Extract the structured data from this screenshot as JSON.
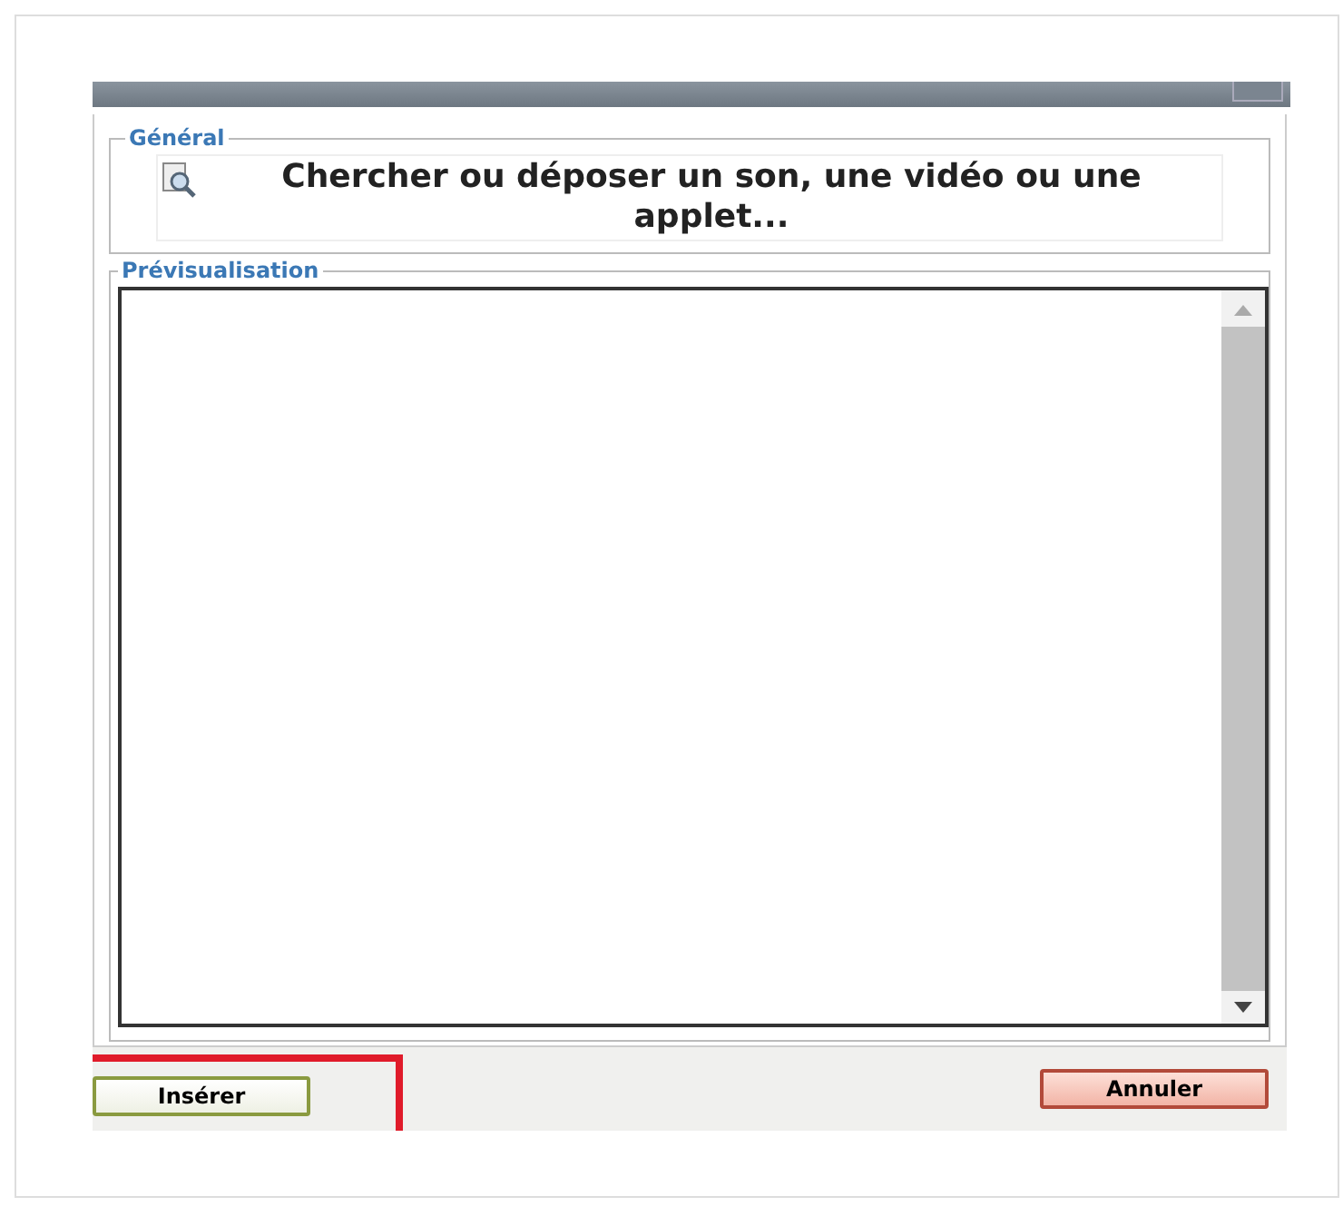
{
  "general": {
    "legend": "Général",
    "search_button": "Chercher ou déposer un son, une vidéo ou une applet..."
  },
  "preview": {
    "legend": "Prévisualisation"
  },
  "buttons": [
    {
      "label": "Insérer",
      "kind": "confirm",
      "highlighted": true
    },
    {
      "label": "Annuler",
      "kind": "cancel",
      "highlighted": false
    }
  ]
}
